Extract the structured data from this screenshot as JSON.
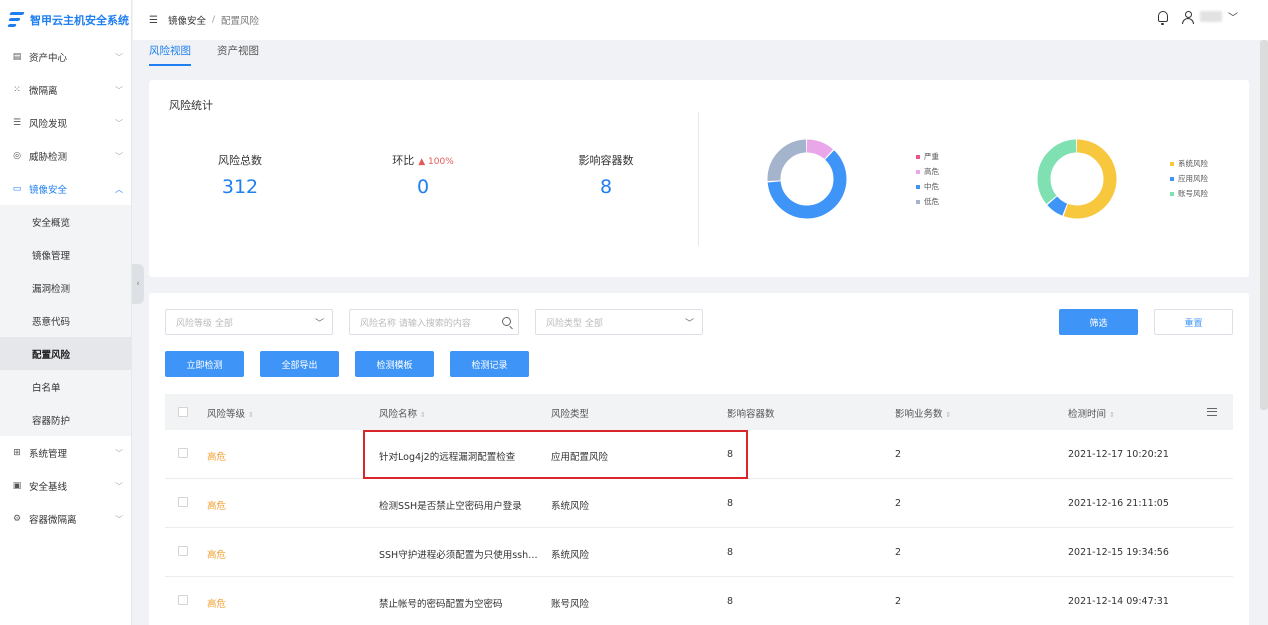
{
  "app": {
    "title": "智甲云主机安全系统"
  },
  "colors": {
    "accent": "#1f7ff0",
    "warning": "#f0a030",
    "highlight": "#d9262b"
  },
  "sidebar": {
    "items": [
      {
        "label": "资产中心",
        "icon": "server-icon"
      },
      {
        "label": "微隔离",
        "icon": "grid-icon"
      },
      {
        "label": "风险发现",
        "icon": "list-search-icon"
      },
      {
        "label": "威胁检测",
        "icon": "target-icon"
      },
      {
        "label": "镜像安全",
        "icon": "folder-icon",
        "active": true
      },
      {
        "label": "系统管理",
        "icon": "apps-icon"
      },
      {
        "label": "安全基线",
        "icon": "monitor-icon"
      },
      {
        "label": "容器微隔离",
        "icon": "cog-icon"
      }
    ],
    "submenu": [
      "安全概览",
      "镜像管理",
      "漏洞检测",
      "恶意代码",
      "配置风险",
      "白名单",
      "容器防护"
    ],
    "active_sub": "配置风险"
  },
  "header": {
    "breadcrumb_parent": "镜像安全",
    "breadcrumb_sep": "/",
    "breadcrumb_current": "配置风险"
  },
  "tabs": [
    "风险视图",
    "资产视图"
  ],
  "stats": {
    "title": "风险统计",
    "total_label": "风险总数",
    "total_value": "312",
    "ratio_label": "环比",
    "ratio_trend": "100%",
    "ratio_value": "0",
    "containers_label": "影响容器数",
    "containers_value": "8"
  },
  "donut1": {
    "legend": [
      {
        "label": "严重",
        "color": "#f0538a"
      },
      {
        "label": "高危",
        "color": "#e9a7ea"
      },
      {
        "label": "中危",
        "color": "#3f95f7"
      },
      {
        "label": "低危",
        "color": "#a5b4cd"
      }
    ],
    "segments": [
      {
        "label": "高危",
        "fraction": 0.12,
        "color": "#e9a7ea"
      },
      {
        "label": "中危",
        "fraction": 0.62,
        "color": "#3f95f7"
      },
      {
        "label": "低危",
        "fraction": 0.26,
        "color": "#a5b4cd"
      }
    ]
  },
  "donut2": {
    "legend": [
      {
        "label": "系统风险",
        "color": "#f7c83d"
      },
      {
        "label": "应用风险",
        "color": "#3f95f7"
      },
      {
        "label": "账号风险",
        "color": "#7fe0b2"
      }
    ],
    "segments": [
      {
        "label": "系统风险",
        "fraction": 0.56,
        "color": "#f7c83d"
      },
      {
        "label": "应用风险",
        "fraction": 0.08,
        "color": "#3f95f7"
      },
      {
        "label": "账号风险",
        "fraction": 0.36,
        "color": "#7fe0b2"
      }
    ]
  },
  "filters": {
    "level_placeholder": "风险等级 全部",
    "name_placeholder": "风险名称 请输入搜索的内容",
    "type_placeholder": "风险类型 全部",
    "filter_btn": "筛选",
    "reset_btn": "重置"
  },
  "actions": [
    "立即检测",
    "全部导出",
    "检测模板",
    "检测记录"
  ],
  "table": {
    "columns": [
      "风险等级",
      "风险名称",
      "风险类型",
      "影响容器数",
      "影响业务数",
      "检测时间"
    ],
    "rows": [
      {
        "level": "高危",
        "name": "针对Log4j2的远程漏洞配置检查",
        "type": "应用配置风险",
        "containers": "8",
        "services": "2",
        "time": "2021-12-17 10:20:21"
      },
      {
        "level": "高危",
        "name": "检测SSH是否禁止空密码用户登录",
        "type": "系统风险",
        "containers": "8",
        "services": "2",
        "time": "2021-12-16 21:11:05"
      },
      {
        "level": "高危",
        "name": "SSH守护进程必须配置为只使用ssh…",
        "type": "系统风险",
        "containers": "8",
        "services": "2",
        "time": "2021-12-15 19:34:56"
      },
      {
        "level": "高危",
        "name": "禁止帐号的密码配置为空密码",
        "type": "账号风险",
        "containers": "8",
        "services": "2",
        "time": "2021-12-14 09:47:31"
      }
    ]
  }
}
